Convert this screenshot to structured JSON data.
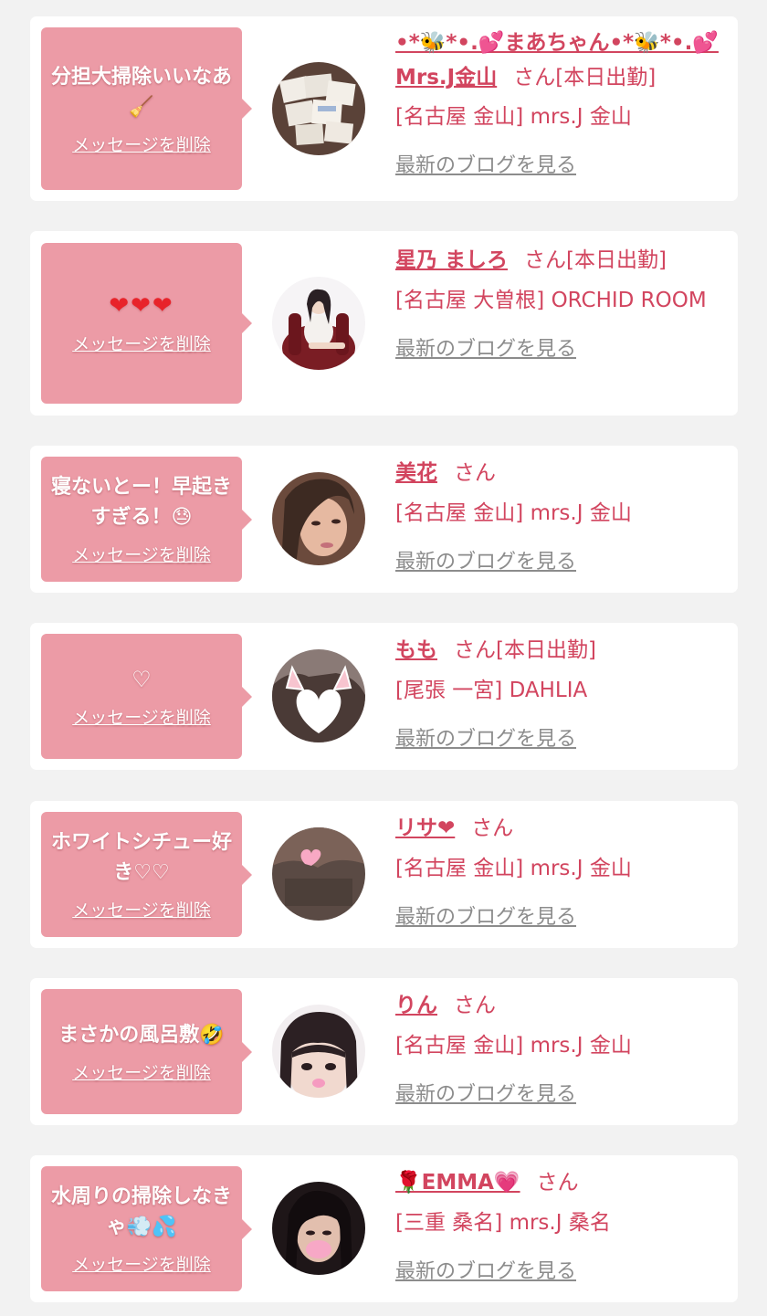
{
  "cards": [
    {
      "message": "分担大掃除いいなあ🧹",
      "delete_label": "メッセージを削除",
      "name": "•*🐝*•.💕まあちゃん•*🐝*•.💕Mrs.J金山",
      "suffix": "さん[本日出勤]",
      "shop": "[名古屋 金山] mrs.J 金山",
      "blog_label": "最新のブログを見る",
      "avatar_icon": "memo-cards-photo"
    },
    {
      "message": "❤❤❤",
      "delete_label": "メッセージを削除",
      "name": "星乃 ましろ",
      "suffix": "さん[本日出勤]",
      "shop": "[名古屋 大曽根] ORCHID ROOM",
      "blog_label": "最新のブログを見る",
      "avatar_icon": "woman-on-red-chair-photo"
    },
    {
      "message": "寝ないとー！早起きすぎる！😓",
      "delete_label": "メッセージを削除",
      "name": "美花",
      "suffix": "さん",
      "shop": "[名古屋 金山] mrs.J 金山",
      "blog_label": "最新のブログを見る",
      "avatar_icon": "woman-portrait-photo"
    },
    {
      "message": "♡",
      "delete_label": "メッセージを削除",
      "name": "もも",
      "suffix": "さん[本日出勤]",
      "shop": "[尾張 一宮] DAHLIA",
      "blog_label": "最新のブログを見る",
      "avatar_icon": "cat-ears-heart-photo"
    },
    {
      "message": "ホワイトシチュー好き♡♡",
      "delete_label": "メッセージを削除",
      "name": "リサ❤",
      "suffix": "さん",
      "shop": "[名古屋 金山] mrs.J 金山",
      "blog_label": "最新のブログを見る",
      "avatar_icon": "lisa-name-photo"
    },
    {
      "message": "まさかの風呂敷🤣",
      "delete_label": "メッセージを削除",
      "name": "りん",
      "suffix": "さん",
      "shop": "[名古屋 金山] mrs.J 金山",
      "blog_label": "最新のブログを見る",
      "avatar_icon": "bangs-face-photo"
    },
    {
      "message": "水周りの掃除しなきゃ💨💦",
      "delete_label": "メッセージを削除",
      "name": "🌹EMMA💗",
      "suffix": "さん",
      "shop": "[三重 桑名] mrs.J 桑名",
      "blog_label": "最新のブログを見る",
      "avatar_icon": "emma-portrait-photo"
    }
  ],
  "colors": {
    "background": "#f2f2f2",
    "bubble": "#ec9ba6",
    "accent_pink": "#d2455f",
    "link_gray": "#8c8c8c"
  }
}
